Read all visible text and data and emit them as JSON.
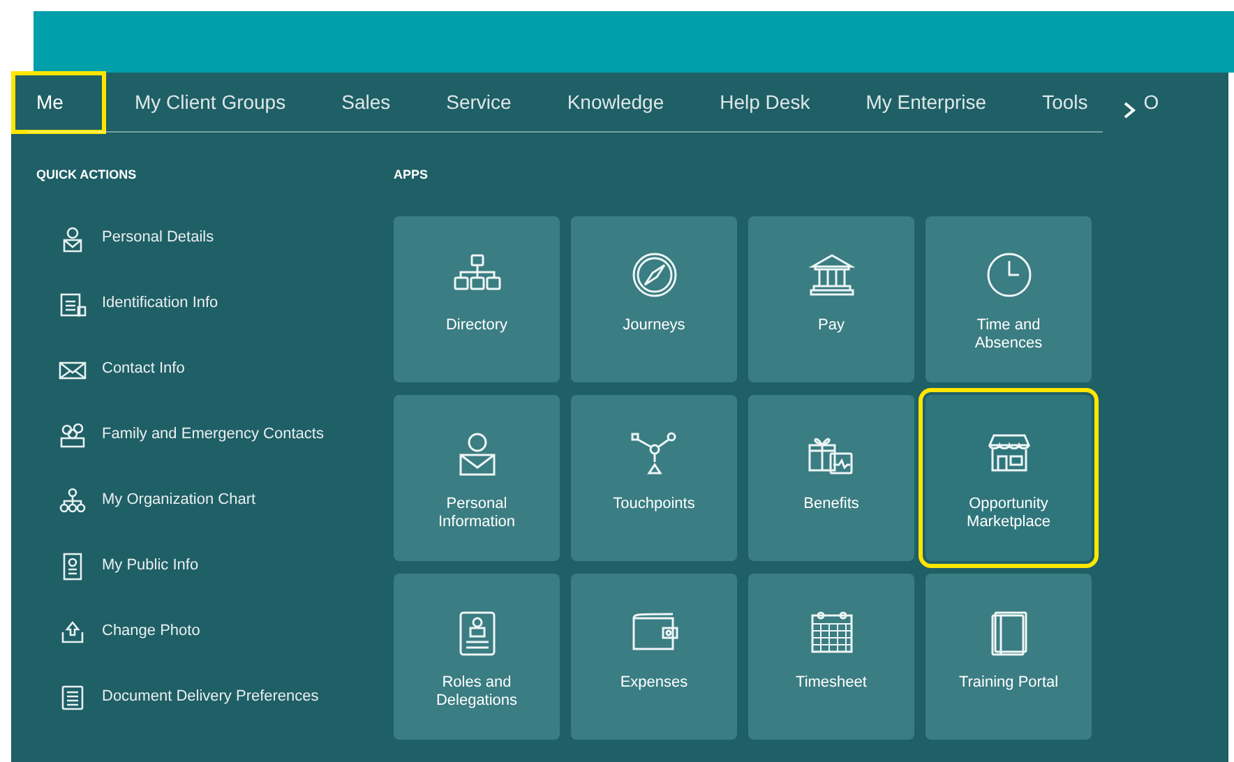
{
  "nav": {
    "tabs": [
      {
        "label": "Me",
        "selected": true,
        "highlighted": true
      },
      {
        "label": "My Client Groups",
        "selected": false,
        "highlighted": false
      },
      {
        "label": "Sales",
        "selected": false,
        "highlighted": false
      },
      {
        "label": "Service",
        "selected": false,
        "highlighted": false
      },
      {
        "label": "Knowledge",
        "selected": false,
        "highlighted": false
      },
      {
        "label": "Help Desk",
        "selected": false,
        "highlighted": false
      },
      {
        "label": "My Enterprise",
        "selected": false,
        "highlighted": false
      },
      {
        "label": "Tools",
        "selected": false,
        "highlighted": false
      },
      {
        "label": "O",
        "selected": false,
        "highlighted": false
      }
    ]
  },
  "quick_actions": {
    "heading": "QUICK ACTIONS",
    "items": [
      {
        "label": "Personal Details"
      },
      {
        "label": "Identification Info"
      },
      {
        "label": "Contact Info"
      },
      {
        "label": "Family and Emergency Contacts"
      },
      {
        "label": "My Organization Chart"
      },
      {
        "label": "My Public Info"
      },
      {
        "label": "Change Photo"
      },
      {
        "label": "Document Delivery Preferences"
      }
    ]
  },
  "apps": {
    "heading": "APPS",
    "tiles": [
      {
        "label": "Directory",
        "highlighted": false
      },
      {
        "label": "Journeys",
        "highlighted": false
      },
      {
        "label": "Pay",
        "highlighted": false
      },
      {
        "label": "Time and Absences",
        "highlighted": false
      },
      {
        "label": "Personal Information",
        "highlighted": false
      },
      {
        "label": "Touchpoints",
        "highlighted": false
      },
      {
        "label": "Benefits",
        "highlighted": false
      },
      {
        "label": "Opportunity Marketplace",
        "highlighted": true
      },
      {
        "label": "Roles and Delegations",
        "highlighted": false
      },
      {
        "label": "Expenses",
        "highlighted": false
      },
      {
        "label": "Timesheet",
        "highlighted": false
      },
      {
        "label": "Training Portal",
        "highlighted": false
      }
    ]
  }
}
